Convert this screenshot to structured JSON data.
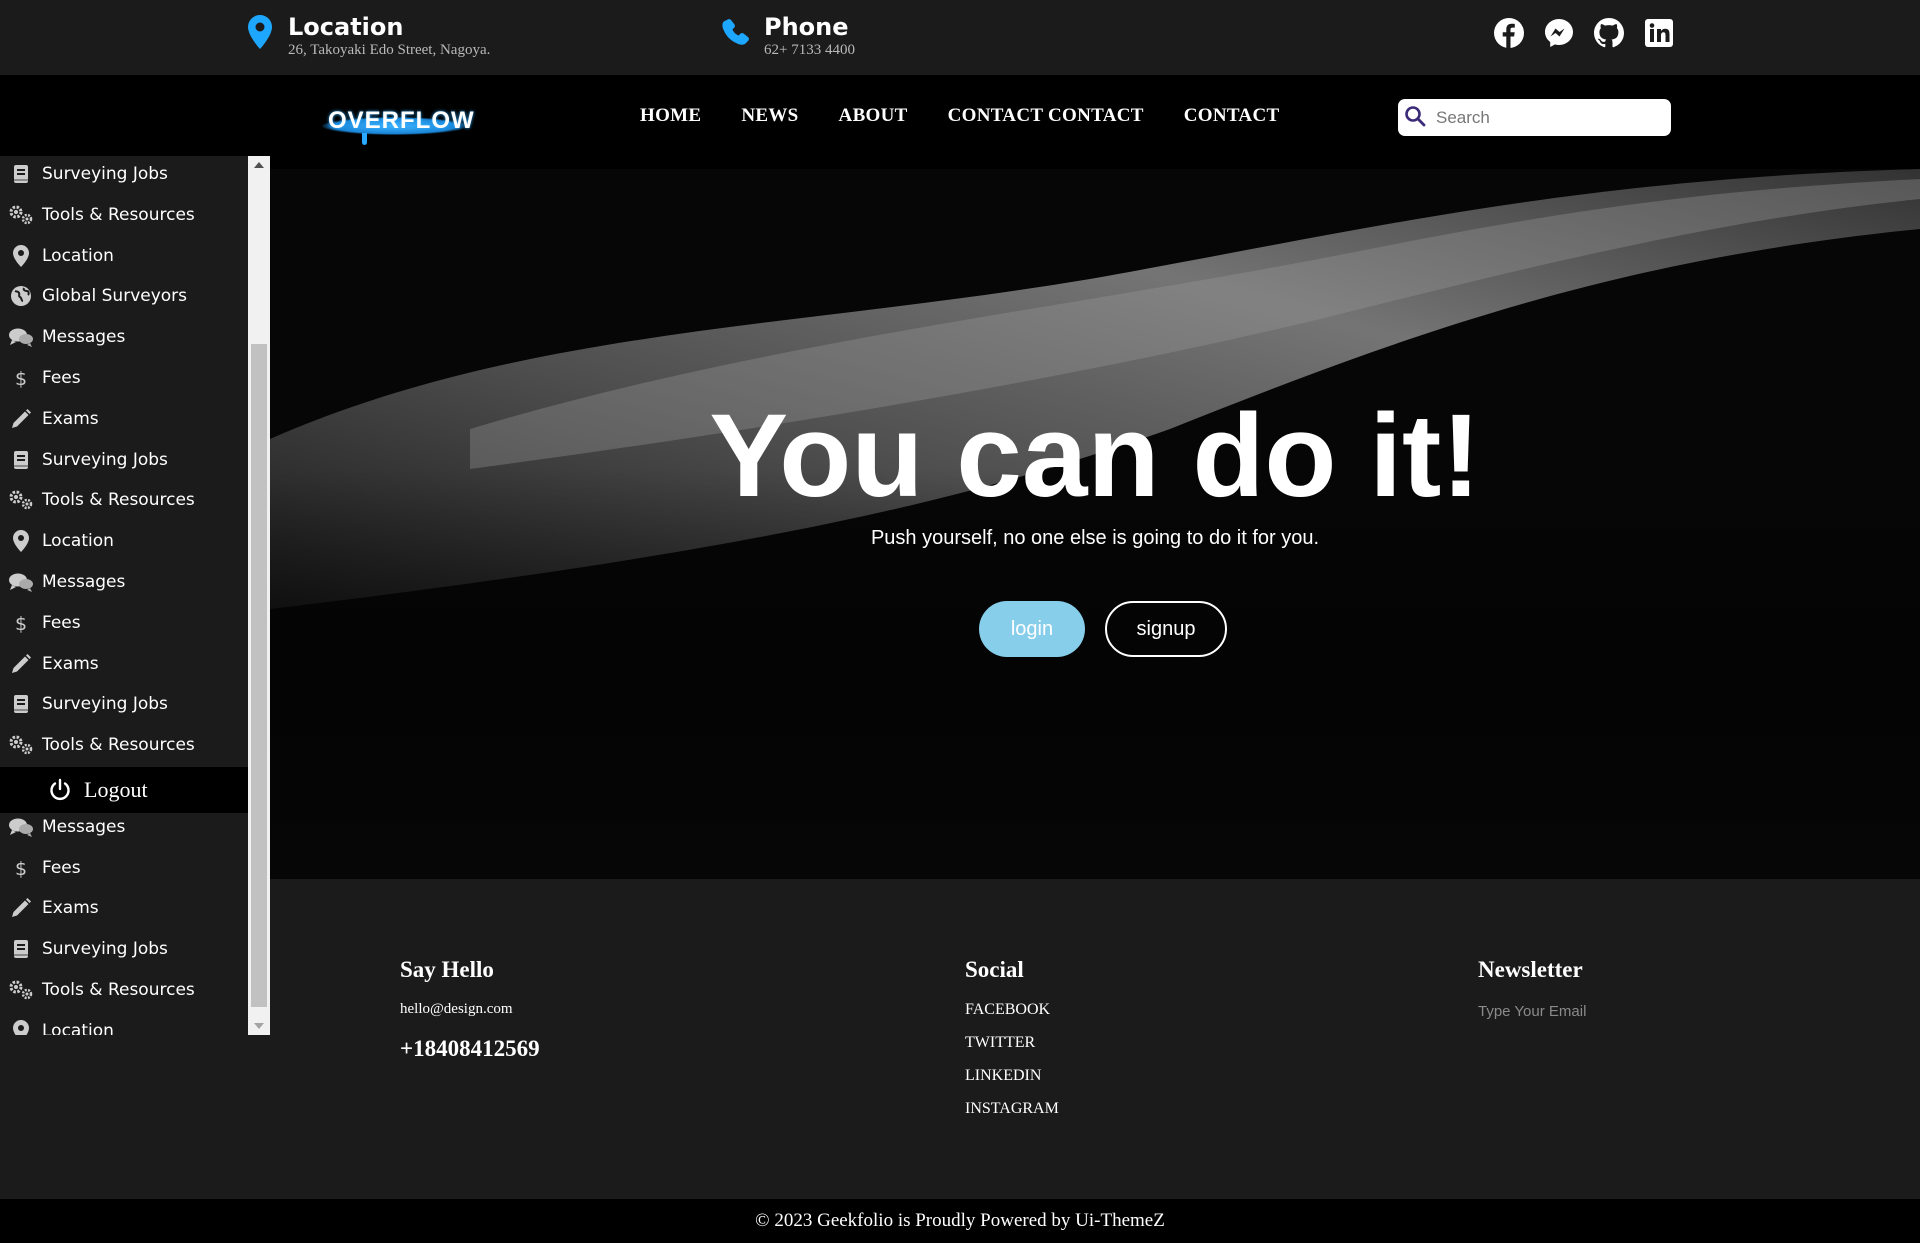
{
  "colors": {
    "accent": "#1ea7ff",
    "login_button": "#87ceeb",
    "topbar_bg": "#1b1b1b",
    "nav_bg": "#000000"
  },
  "topbar": {
    "location": {
      "icon": "map-pin-icon",
      "title": "Location",
      "subtitle": "26, Takoyaki Edo Street, Nagoya."
    },
    "phone": {
      "icon": "phone-icon",
      "title": "Phone",
      "subtitle": "62+ 7133 4400"
    },
    "socials": [
      "facebook-icon",
      "messenger-icon",
      "github-icon",
      "linkedin-icon"
    ]
  },
  "navbar": {
    "logo": "OVERFLOW",
    "links": [
      "HOME",
      "NEWS",
      "ABOUT",
      "CONTACT CONTACT",
      "CONTACT"
    ],
    "search_placeholder": "Search"
  },
  "hero": {
    "title": "You can do it!",
    "subtitle": "Push yourself, no one else is going to do it for you.",
    "login_label": "login",
    "signup_label": "signup"
  },
  "sidebar": {
    "items": [
      {
        "label": "Surveying Jobs",
        "icon": "book-icon"
      },
      {
        "label": "Tools & Resources",
        "icon": "gears-icon"
      },
      {
        "label": "Location",
        "icon": "map-pin-icon"
      },
      {
        "label": "Global Surveyors",
        "icon": "globe-icon"
      },
      {
        "label": "Messages",
        "icon": "chat-icon"
      },
      {
        "label": "Fees",
        "icon": "dollar-icon"
      },
      {
        "label": "Exams",
        "icon": "pencil-icon"
      },
      {
        "label": "Surveying Jobs",
        "icon": "book-icon"
      },
      {
        "label": "Tools & Resources",
        "icon": "gears-icon"
      },
      {
        "label": "Location",
        "icon": "map-pin-icon"
      },
      {
        "label": "Messages",
        "icon": "chat-icon"
      },
      {
        "label": "Fees",
        "icon": "dollar-icon"
      },
      {
        "label": "Exams",
        "icon": "pencil-icon"
      },
      {
        "label": "Surveying Jobs",
        "icon": "book-icon"
      },
      {
        "label": "Tools & Resources",
        "icon": "gears-icon"
      },
      {
        "label": "",
        "icon": "map-pin-icon"
      },
      {
        "label": "Messages",
        "icon": "chat-icon"
      },
      {
        "label": "Fees",
        "icon": "dollar-icon"
      },
      {
        "label": "Exams",
        "icon": "pencil-icon"
      },
      {
        "label": "Surveying Jobs",
        "icon": "book-icon"
      },
      {
        "label": "Tools & Resources",
        "icon": "gears-icon"
      },
      {
        "label": "Location",
        "icon": "map-pin-icon"
      }
    ],
    "logout_label": "Logout"
  },
  "footer": {
    "say_hello": {
      "title": "Say Hello",
      "email": "hello@design.com",
      "phone": "+18408412569"
    },
    "social": {
      "title": "Social",
      "links": [
        "FACEBOOK",
        "TWITTER",
        "LINKEDIN",
        "INSTAGRAM"
      ]
    },
    "newsletter": {
      "title": "Newsletter",
      "placeholder": "Type Your Email"
    },
    "copyright": "© 2023 Geekfolio is Proudly Powered by Ui-ThemeZ"
  }
}
